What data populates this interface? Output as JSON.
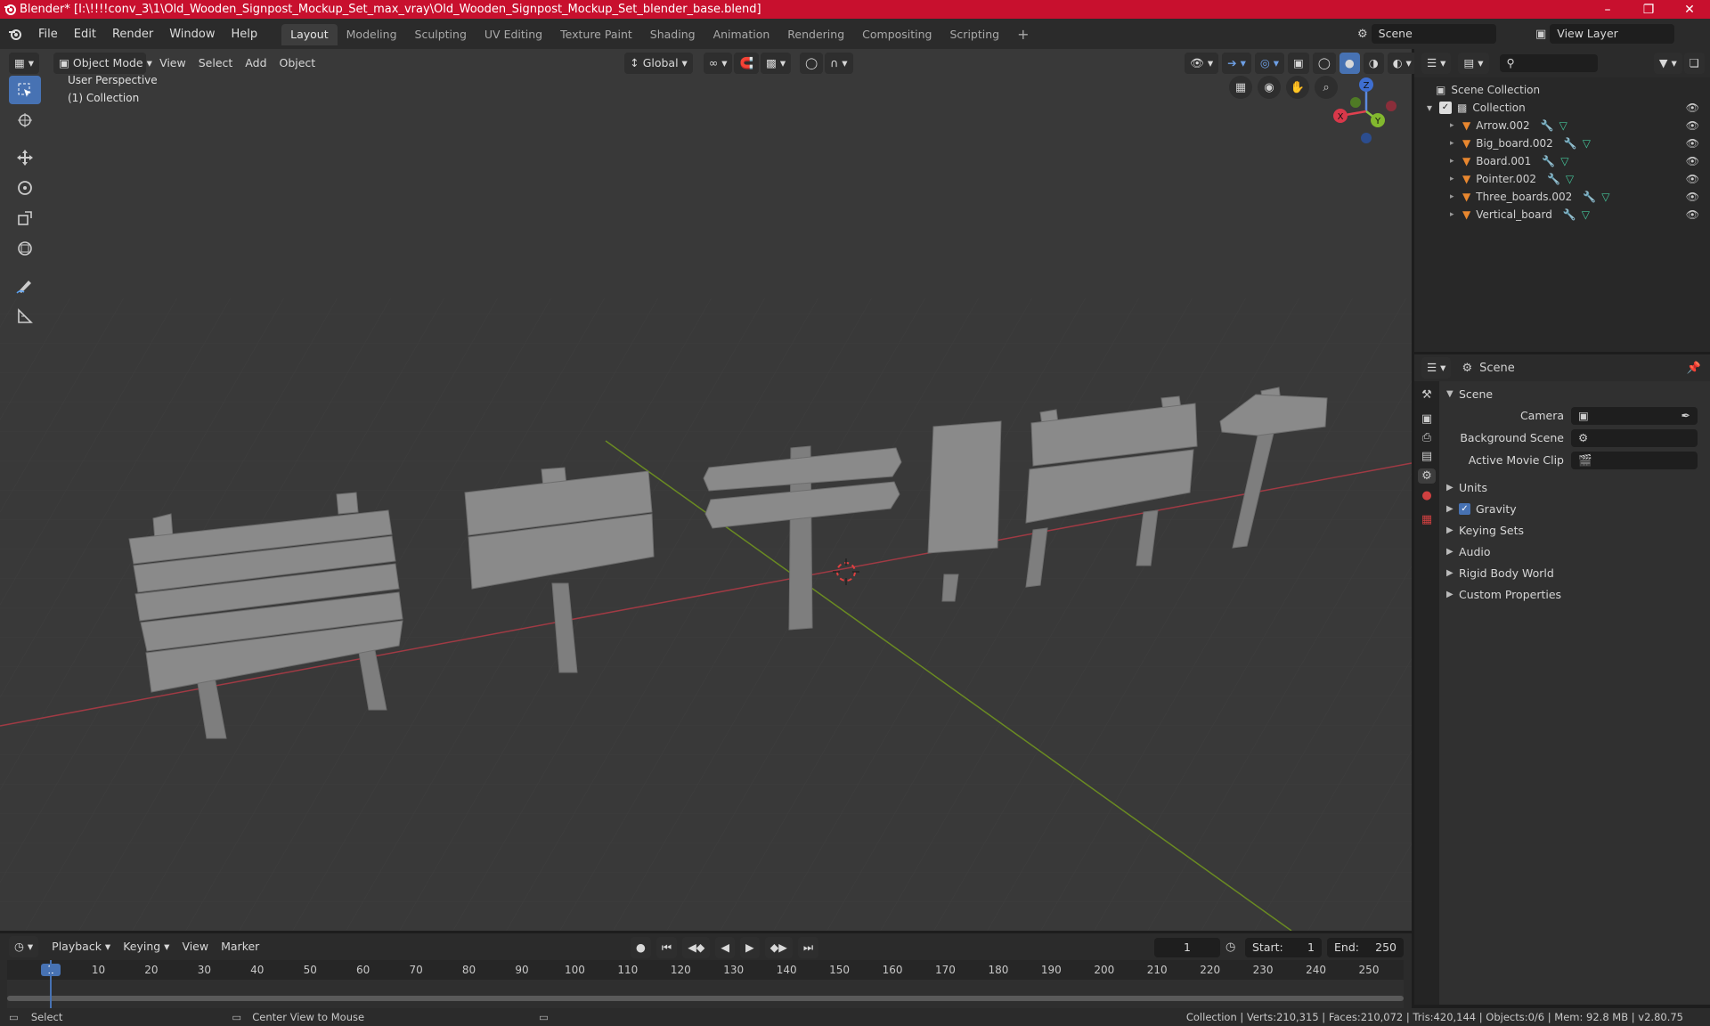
{
  "app": {
    "window_title": "Blender* [I:\\!!!!conv_3\\1\\Old_Wooden_Signpost_Mockup_Set_max_vray\\Old_Wooden_Signpost_Mockup_Set_blender_base.blend]",
    "title_bar_color": "#c8102e"
  },
  "menu": {
    "items": [
      "File",
      "Edit",
      "Render",
      "Window",
      "Help"
    ]
  },
  "workspaces": [
    "Layout",
    "Modeling",
    "Sculpting",
    "UV Editing",
    "Texture Paint",
    "Shading",
    "Animation",
    "Rendering",
    "Compositing",
    "Scripting"
  ],
  "active_workspace": "Layout",
  "scene_selector": "Scene",
  "view_layer_selector": "View Layer",
  "viewport": {
    "mode": "Object Mode",
    "menus": [
      "View",
      "Select",
      "Add",
      "Object"
    ],
    "transform_orientation": "Global",
    "overlay_line1": "User Perspective",
    "overlay_line2": "(1) Collection",
    "gizmo": {
      "x": "X",
      "y": "Y",
      "z": "Z"
    },
    "background_color": "#393939",
    "axis_x_color": "#a03a44",
    "axis_y_color": "#6a8a22"
  },
  "outliner": {
    "root": "Scene Collection",
    "collection": "Collection",
    "objects": [
      "Arrow.002",
      "Big_board.002",
      "Board.001",
      "Pointer.002",
      "Three_boards.002",
      "Vertical_board"
    ]
  },
  "properties": {
    "header": "Scene",
    "panel_title": "Scene",
    "fields": [
      {
        "label": "Camera",
        "value": ""
      },
      {
        "label": "Background Scene",
        "value": ""
      },
      {
        "label": "Active Movie Clip",
        "value": ""
      }
    ],
    "sections": [
      "Units",
      "Gravity",
      "Keying Sets",
      "Audio",
      "Rigid Body World",
      "Custom Properties"
    ],
    "gravity_checked": true
  },
  "timeline": {
    "menus": [
      "Playback",
      "Keying",
      "View",
      "Marker"
    ],
    "current_frame": "1",
    "start_label": "Start:",
    "start": "1",
    "end_label": "End:",
    "end": "250",
    "ruler": [
      "1",
      "10",
      "20",
      "30",
      "40",
      "50",
      "60",
      "70",
      "80",
      "90",
      "100",
      "110",
      "120",
      "130",
      "140",
      "150",
      "160",
      "170",
      "180",
      "190",
      "200",
      "210",
      "220",
      "230",
      "240",
      "250"
    ]
  },
  "statusbar": {
    "left_action": "Select",
    "middle_action": "Center View to Mouse",
    "stats": "Collection | Verts:210,315 | Faces:210,072 | Tris:420,144 | Objects:0/6 | Mem: 92.8 MB | v2.80.75"
  },
  "colors": {
    "accent_blue": "#4772b3",
    "object_orange": "#e8872f",
    "modifier_blue": "#6ea0e6",
    "mesh_green": "#44c59a"
  }
}
